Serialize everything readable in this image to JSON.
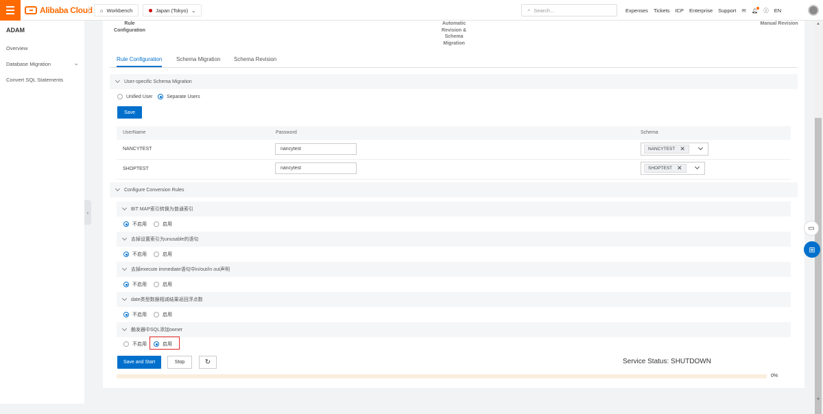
{
  "topbar": {
    "brand": "Alibaba Cloud",
    "workbench": "Workbench",
    "region": "Japan (Tokyo)",
    "search_placeholder": "Search...",
    "links": [
      "Expenses",
      "Tickets",
      "ICP",
      "Enterprise",
      "Support"
    ],
    "lang": "EN"
  },
  "sidebar": {
    "title": "ADAM",
    "items": [
      {
        "label": "Overview"
      },
      {
        "label": "Database Migration"
      },
      {
        "label": "Convert SQL Statements"
      }
    ]
  },
  "steps": {
    "step1": [
      "Rule",
      "Configuration"
    ],
    "step2": [
      "Automatic",
      "Revision &",
      "Schema",
      "Migration"
    ],
    "step3": "Manual Revision"
  },
  "tabs": [
    {
      "label": "Rule Configuration",
      "active": true
    },
    {
      "label": "Schema Migration",
      "active": false
    },
    {
      "label": "Schema Revision",
      "active": false
    }
  ],
  "user_schema": {
    "section_title": "User-specific Schema Migration",
    "options": [
      {
        "label": "Unified User",
        "selected": false
      },
      {
        "label": "Separate Users",
        "selected": true
      }
    ],
    "save_label": "Save",
    "columns": [
      "UserName",
      "Password",
      "Schema"
    ],
    "rows": [
      {
        "username": "NANCYTEST",
        "password": "nancytest",
        "schema": "NANCYTEST"
      },
      {
        "username": "SHOPTEST",
        "password": "nancytest",
        "schema": "SHOPTEST"
      }
    ]
  },
  "conversion": {
    "section_title": "Configure Conversion Rules",
    "rules": [
      {
        "title": "BIT MAP索引转换为普通索引",
        "off_label": "不启用",
        "on_label": "启用",
        "enabled": false
      },
      {
        "title": "去掉设置索引为unusable的语句",
        "off_label": "不启用",
        "on_label": "启用",
        "enabled": false
      },
      {
        "title": "去掉execute immediate语句中in/out/in out声明",
        "off_label": "不启用",
        "on_label": "启用",
        "enabled": false
      },
      {
        "title": "date类型数据相减结果返回浮点数",
        "off_label": "不启用",
        "on_label": "启用",
        "enabled": false
      },
      {
        "title": "触发器中SQL添加owner",
        "off_label": "不启用",
        "on_label": "启用",
        "enabled": true
      }
    ]
  },
  "footer": {
    "save_start_label": "Save and Start",
    "stop_label": "Stop",
    "refresh_icon": "refresh-icon",
    "status_text": "Service Status: SHUTDOWN",
    "progress_percent": 0,
    "progress_text": "0%"
  },
  "colors": {
    "brand": "#ff6a00",
    "primary": "#0070cc",
    "highlight": "#e02020"
  }
}
